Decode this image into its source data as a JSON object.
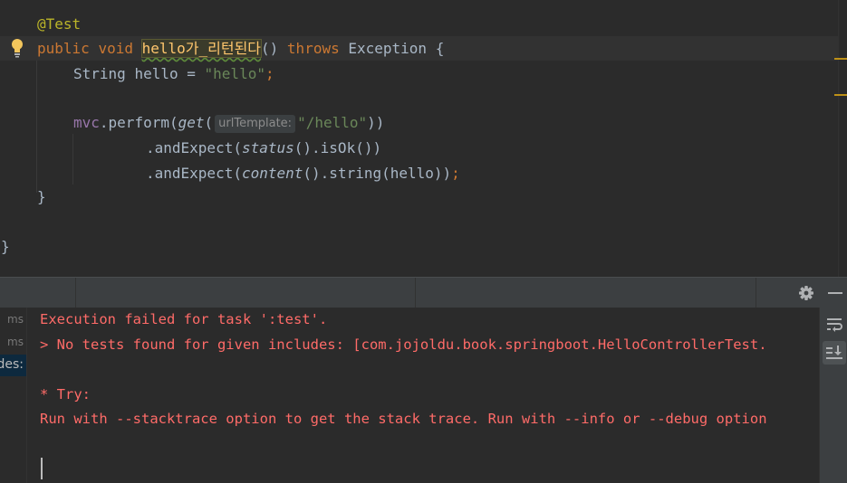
{
  "editor": {
    "lines": {
      "annotation": "@Test",
      "sig_public": "public",
      "sig_void": "void",
      "sig_method": "hello가_리턴된다",
      "sig_paren": "()",
      "sig_throws": "throws",
      "sig_exception": "Exception",
      "sig_brace": "{",
      "decl_type": "String",
      "decl_name": "hello",
      "decl_eq": "=",
      "decl_value": "\"hello\"",
      "decl_semi": ";",
      "perform_obj": "mvc",
      "perform_call": ".perform(",
      "perform_get": "get",
      "perform_open": "(",
      "perform_hint": "urlTemplate:",
      "perform_arg": "\"/hello\"",
      "perform_close": "))",
      "expect1_a": ".andExpect(",
      "expect1_status": "status",
      "expect1_b": "().isOk())",
      "expect2_a": ".andExpect(",
      "expect2_content": "content",
      "expect2_b": "().string(hello))",
      "expect2_semi": ";",
      "method_close": "}",
      "class_close": "}"
    }
  },
  "run_panel": {
    "left_items": [
      "ms",
      "ms",
      "des:"
    ],
    "console_lines": [
      "Execution failed for task ':test'.",
      "> No tests found for given includes: [com.jojoldu.book.springboot.HelloControllerTest.",
      "",
      "* Try:",
      "Run with --stacktrace option to get the stack trace. Run with --info or --debug option"
    ],
    "icons": {
      "settings": "gear-icon",
      "hide": "minimize-icon",
      "soft_wrap": "soft-wrap-icon",
      "scroll_to_end": "scroll-to-end-icon",
      "intention": "lightbulb-icon"
    }
  },
  "colors": {
    "editor_bg": "#2b2b2b",
    "keyword": "#cc7832",
    "string": "#6a8759",
    "annotation": "#bbb529",
    "error_text": "#ff6b68",
    "panel_header": "#3c3f41"
  }
}
